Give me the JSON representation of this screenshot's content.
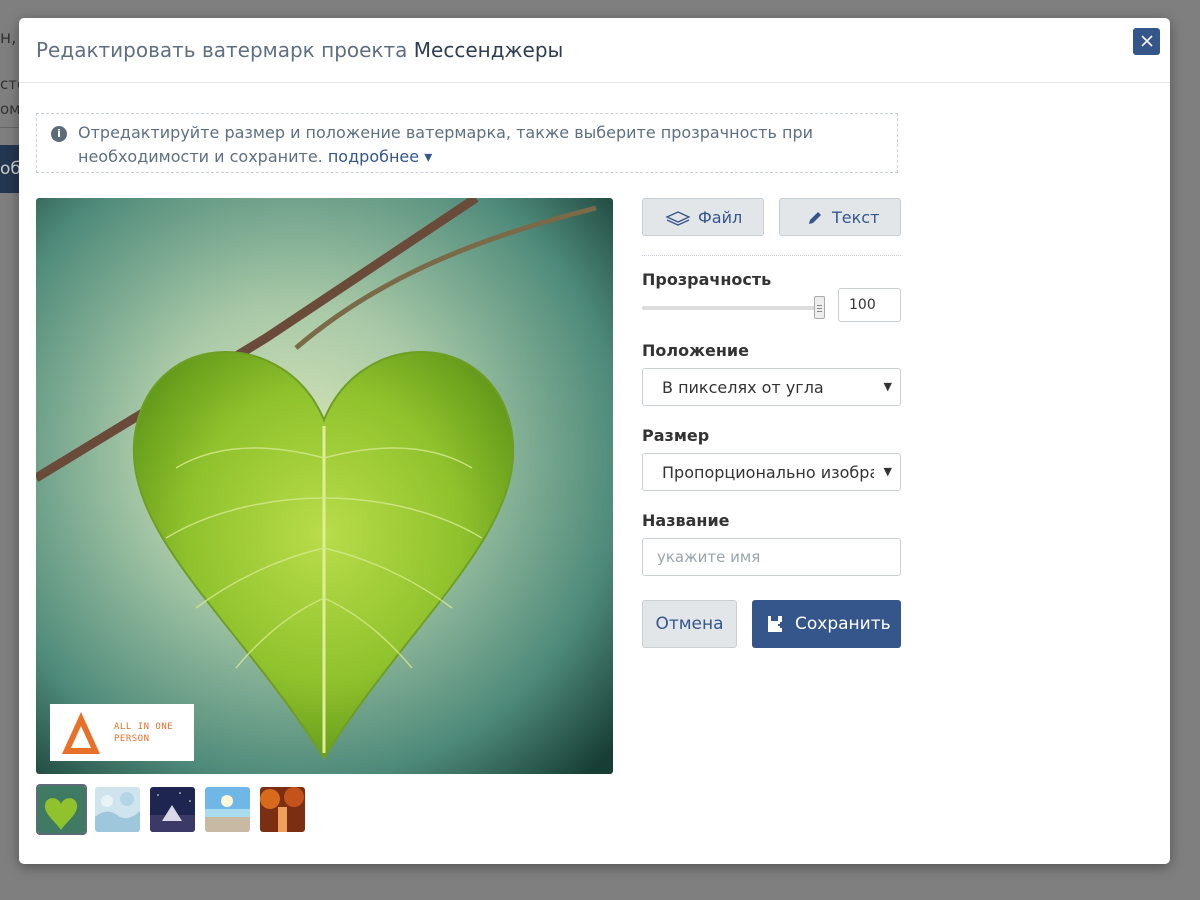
{
  "background": {
    "fragment_top": "н,",
    "fragment_2": "сто",
    "fragment_3": "ом",
    "fragment_btn": "об"
  },
  "modal": {
    "title_prefix": "Редактировать ватермарк проекта",
    "project_name": "Мессенджеры",
    "close_icon": "close-icon"
  },
  "info": {
    "icon": "info-icon",
    "text": "Отредактируйте размер и положение ватермарка, также выберите прозрачность при необходимости и сохраните.",
    "link": "подробнее ▾"
  },
  "preview": {
    "watermark_text_line1": "ALL IN ONE",
    "watermark_text_line2": "PERSON",
    "watermark_logo_letter": "A"
  },
  "thumbnails": [
    {
      "name": "leaf-heart",
      "active": true
    },
    {
      "name": "snow",
      "active": false
    },
    {
      "name": "mountain-night",
      "active": false
    },
    {
      "name": "sea-pier",
      "active": false
    },
    {
      "name": "autumn-forest",
      "active": false
    }
  ],
  "tools": {
    "file_label": "Файл",
    "text_label": "Текст"
  },
  "form": {
    "opacity_label": "Прозрачность",
    "opacity_value": "100",
    "opacity_fraction": 1.0,
    "position_label": "Положение",
    "position_value": "В пикселях от угла",
    "size_label": "Размер",
    "size_value": "Пропорционально изображению",
    "name_label": "Название",
    "name_placeholder": "укажите имя",
    "name_value": ""
  },
  "actions": {
    "cancel_label": "Отмена",
    "save_label": "Сохранить"
  },
  "colors": {
    "primary": "#34568b",
    "overlay": "#808080",
    "accent_orange": "#e8712a"
  }
}
